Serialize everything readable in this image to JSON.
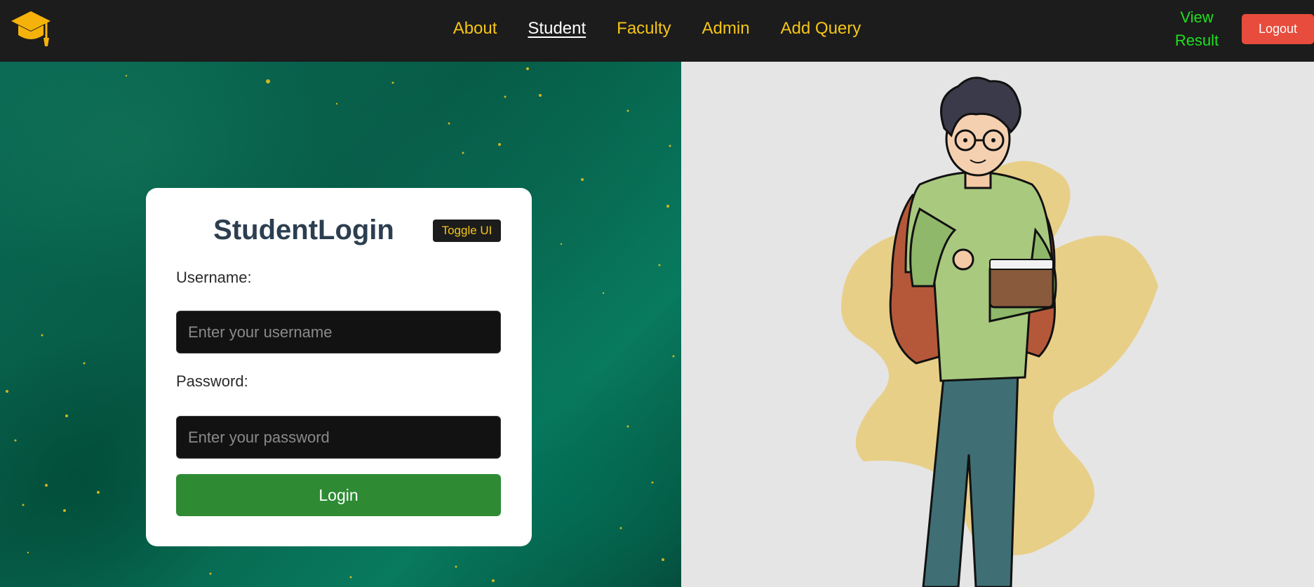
{
  "nav": {
    "logo_icon": "graduation-cap-icon",
    "links": [
      {
        "label": "About",
        "active": false
      },
      {
        "label": "Student",
        "active": true
      },
      {
        "label": "Faculty",
        "active": false
      },
      {
        "label": "Admin",
        "active": false
      },
      {
        "label": "Add Query",
        "active": false
      }
    ],
    "view_result_line1": "View",
    "view_result_line2": "Result",
    "logout_label": "Logout"
  },
  "login": {
    "title": "StudentLogin",
    "toggle_label": "Toggle UI",
    "username_label": "Username:",
    "username_placeholder": "Enter your username",
    "password_label": "Password:",
    "password_placeholder": "Enter your password",
    "submit_label": "Login"
  },
  "colors": {
    "nav_bg": "#1c1c1c",
    "nav_link": "#f5c518",
    "view_result": "#1fe01f",
    "logout_bg": "#e74c3c",
    "login_btn": "#2e8b34",
    "title": "#2c3e50"
  },
  "illustration": {
    "icon": "student-with-backpack-illustration"
  }
}
